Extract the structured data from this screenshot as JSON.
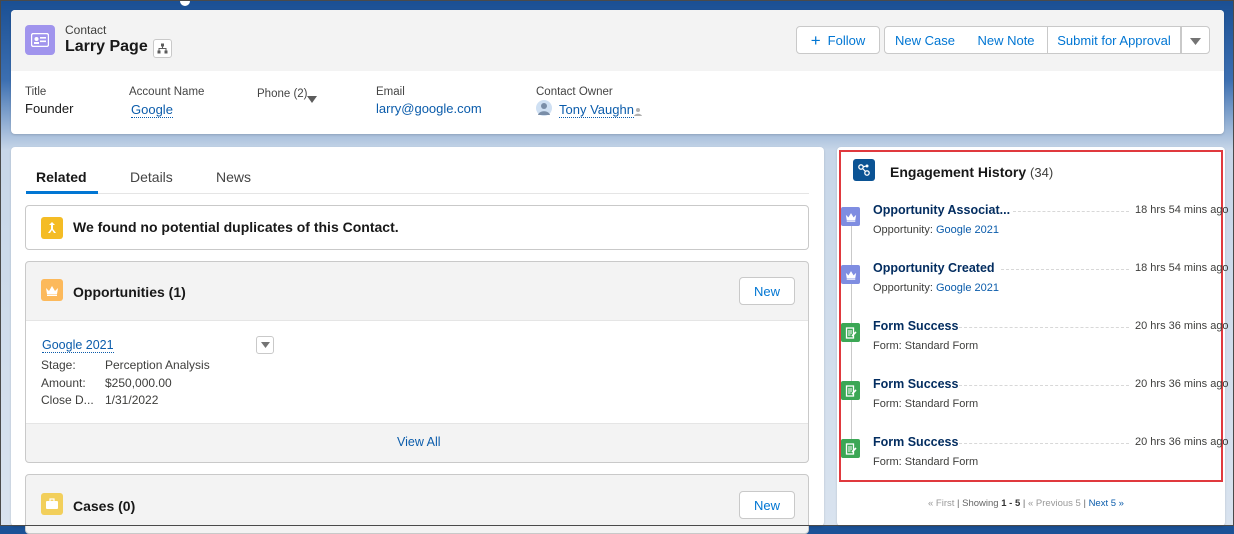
{
  "header": {
    "object_label": "Contact",
    "record_name": "Larry Page",
    "buttons": {
      "follow": "Follow",
      "new_case": "New Case",
      "new_note": "New Note",
      "submit_for_approval": "Submit for Approval"
    },
    "fields": {
      "title_label": "Title",
      "title_value": "Founder",
      "account_label": "Account Name",
      "account_value": "Google",
      "phone_label": "Phone (2)",
      "email_label": "Email",
      "email_value": "larry@google.com",
      "owner_label": "Contact Owner",
      "owner_value": "Tony Vaughn"
    }
  },
  "tabs": [
    "Related",
    "Details",
    "News"
  ],
  "duplicates_message": "We found no potential duplicates of this Contact.",
  "opportunities": {
    "title": "Opportunities (1)",
    "new_label": "New",
    "record": {
      "name": "Google 2021",
      "stage_label": "Stage:",
      "stage_value": "Perception Analysis",
      "amount_label": "Amount:",
      "amount_value": "$250,000.00",
      "close_label": "Close D...",
      "close_value": "1/31/2022"
    },
    "view_all": "View All"
  },
  "cases": {
    "title": "Cases (0)",
    "new_label": "New"
  },
  "engagement": {
    "title": "Engagement History",
    "count": "(34)",
    "events": [
      {
        "title": "Opportunity Associat...",
        "sub_label": "Opportunity: ",
        "sub_link": "Google 2021",
        "sub_text": "",
        "time": "18 hrs 54 mins ago",
        "icon": "crown-icon"
      },
      {
        "title": "Opportunity Created",
        "sub_label": "Opportunity: ",
        "sub_link": "Google 2021",
        "sub_text": "",
        "time": "18 hrs 54 mins ago",
        "icon": "crown-icon"
      },
      {
        "title": "Form Success",
        "sub_label": "",
        "sub_link": "",
        "sub_text": "Form: Standard Form",
        "time": "20 hrs 36 mins ago",
        "icon": "form-icon"
      },
      {
        "title": "Form Success",
        "sub_label": "",
        "sub_link": "",
        "sub_text": "Form: Standard Form",
        "time": "20 hrs 36 mins ago",
        "icon": "form-icon"
      },
      {
        "title": "Form Success",
        "sub_label": "",
        "sub_link": "",
        "sub_text": "Form: Standard Form",
        "time": "20 hrs 36 mins ago",
        "icon": "form-icon"
      }
    ],
    "pager": {
      "first": "« First",
      "showing": "Showing",
      "range": "1 - 5",
      "previous": "« Previous 5",
      "next": "Next 5 »"
    }
  },
  "colors": {
    "contact_icon": "#a094ed",
    "opportunity_icon": "#fcb95b",
    "case_icon": "#f2cf5b",
    "duplicate_icon": "#f4bc25",
    "engagement_icon": "#0b5394",
    "crown_event": "#7f8de1",
    "form_event": "#3ba755",
    "highlight_border": "#e0393e"
  }
}
